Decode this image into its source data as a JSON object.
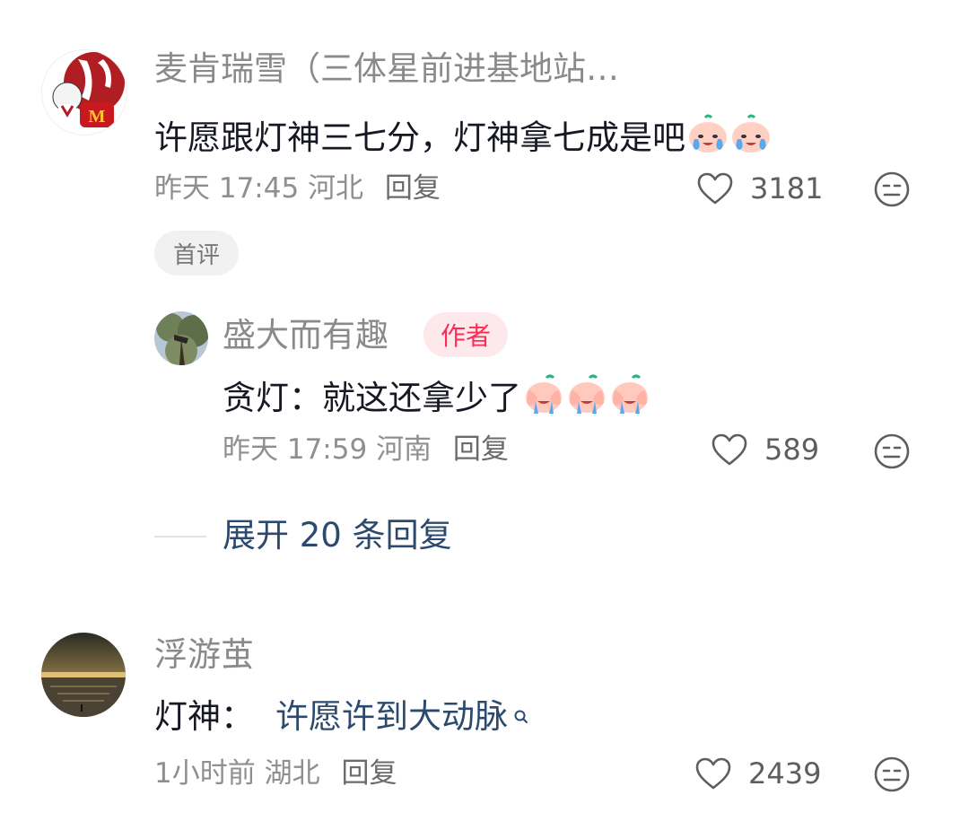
{
  "comments": [
    {
      "username": "麦肯瑞雪（三体星前进基地站…",
      "text": "许愿跟灯神三七分，灯神拿七成是吧",
      "emoji_count": 2,
      "time": "昨天 17:45",
      "location": "河北",
      "reply_label": "回复",
      "likes": "3181",
      "badge": "首评",
      "avatar_icon": "kfc-mcdonalds-avatar"
    },
    {
      "username": "浮游茧",
      "text_prefix": "灯神：",
      "link_text": "许愿许到大动脉",
      "time": "1小时前",
      "location": "湖北",
      "reply_label": "回复",
      "likes": "2439",
      "avatar_icon": "sunset-sea-avatar"
    }
  ],
  "reply": {
    "username": "盛大而有趣",
    "author_badge": "作者",
    "text": "贪灯：就这还拿少了",
    "emoji_count": 3,
    "time": "昨天 17:59",
    "location": "河南",
    "reply_label": "回复",
    "likes": "589",
    "avatar_icon": "tree-avatar"
  },
  "expand_replies": "展开 20 条回复",
  "colors": {
    "text": "#161823",
    "muted": "#8a8a8a",
    "link": "#2c4a6e",
    "author_badge": "#fe2c55"
  }
}
